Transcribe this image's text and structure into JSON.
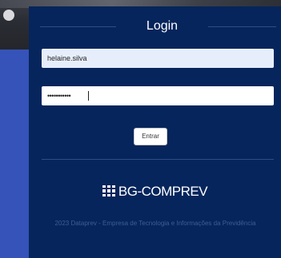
{
  "login": {
    "title": "Login",
    "username_value": "helaine.silva",
    "password_value": "•••••••••••",
    "submit_label": "Entrar"
  },
  "brand": {
    "name": "BG-COMPREV",
    "icon": "grid-icon"
  },
  "footer": {
    "text": "2023 Dataprev - Empresa de Tecnologia e Informações da Previdência"
  },
  "colors": {
    "panel_bg": "#06255c",
    "page_bg": "#3553b8",
    "input_autofill_bg": "#e7eefb"
  }
}
